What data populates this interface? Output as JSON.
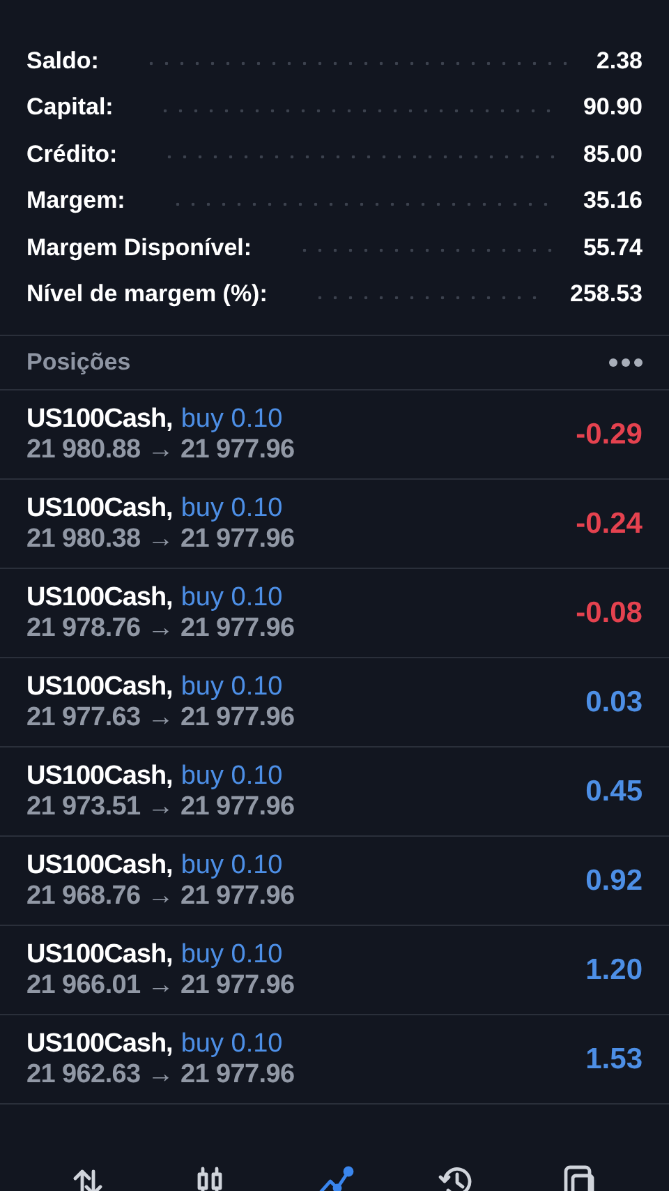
{
  "summary": [
    {
      "label": "Saldo:",
      "value": "2.38"
    },
    {
      "label": "Capital:",
      "value": "90.90"
    },
    {
      "label": "Crédito:",
      "value": "85.00"
    },
    {
      "label": "Margem:",
      "value": "35.16"
    },
    {
      "label": "Margem Disponível:",
      "value": "55.74"
    },
    {
      "label": "Nível de margem (%):",
      "value": "258.53"
    }
  ],
  "positions": {
    "title": "Posições",
    "items": [
      {
        "symbol": "US100Cash,",
        "order": "buy 0.10",
        "prices": "21 980.88 → 21 977.96",
        "profit": "-0.29",
        "color": "#e5424f"
      },
      {
        "symbol": "US100Cash,",
        "order": "buy 0.10",
        "prices": "21 980.38 → 21 977.96",
        "profit": "-0.24",
        "color": "#e5424f"
      },
      {
        "symbol": "US100Cash,",
        "order": "buy 0.10",
        "prices": "21 978.76 → 21 977.96",
        "profit": "-0.08",
        "color": "#e5424f"
      },
      {
        "symbol": "US100Cash,",
        "order": "buy 0.10",
        "prices": "21 977.63 → 21 977.96",
        "profit": "0.03",
        "color": "#4d8fe6"
      },
      {
        "symbol": "US100Cash,",
        "order": "buy 0.10",
        "prices": "21 973.51 → 21 977.96",
        "profit": "0.45",
        "color": "#4d8fe6"
      },
      {
        "symbol": "US100Cash,",
        "order": "buy 0.10",
        "prices": "21 968.76 → 21 977.96",
        "profit": "0.92",
        "color": "#4d8fe6"
      },
      {
        "symbol": "US100Cash,",
        "order": "buy 0.10",
        "prices": "21 966.01 → 21 977.96",
        "profit": "1.20",
        "color": "#4d8fe6"
      },
      {
        "symbol": "US100Cash,",
        "order": "buy 0.10",
        "prices": "21 962.63 → 21 977.96",
        "profit": "1.53",
        "color": "#4d8fe6"
      }
    ]
  },
  "nav": [
    {
      "selected": false
    },
    {
      "selected": false
    },
    {
      "selected": true
    },
    {
      "selected": false
    },
    {
      "selected": false
    }
  ]
}
